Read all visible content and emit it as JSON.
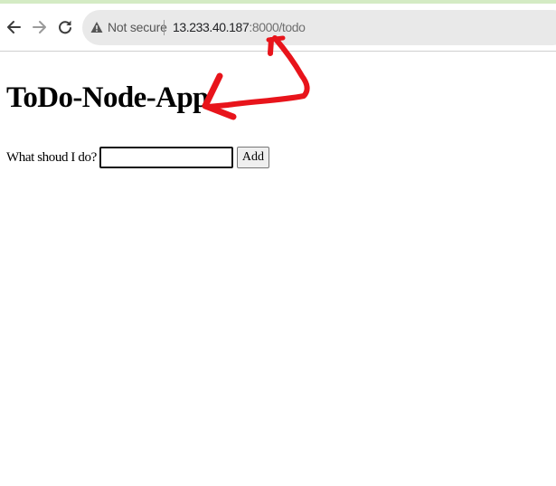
{
  "browser": {
    "security_label": "Not secure",
    "url_host": "13.233.40.187",
    "url_path": ":8000/todo",
    "icons": {
      "back": "back-arrow-icon",
      "forward": "forward-arrow-icon",
      "reload": "reload-icon",
      "security": "warning-triangle-icon"
    }
  },
  "page": {
    "title": "ToDo-Node-App",
    "form": {
      "label": "What shoud I do?",
      "input_value": "",
      "add_button_label": "Add"
    }
  },
  "colors": {
    "annotation_arrow": "#e8141b",
    "omnibox_background": "#e9e9e9",
    "top_accent": "#d4ebc4"
  }
}
